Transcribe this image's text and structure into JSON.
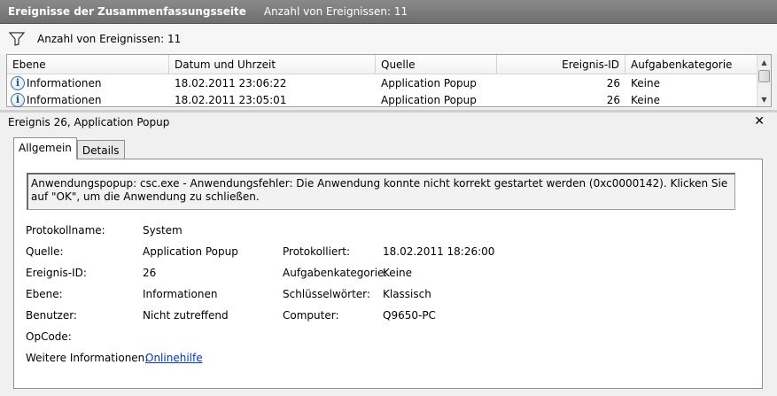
{
  "header": {
    "title": "Ereignisse der Zusammenfassungsseite",
    "count_label": "Anzahl von Ereignissen: 11"
  },
  "filter": {
    "label": "Anzahl von Ereignissen: 11",
    "icon": "filter-icon"
  },
  "grid": {
    "columns": [
      "Ebene",
      "Datum und Uhrzeit",
      "Quelle",
      "Ereignis-ID",
      "Aufgabenkategorie"
    ],
    "rows": [
      {
        "level": "Informationen",
        "datetime": "18.02.2011 23:06:22",
        "source": "Application Popup",
        "event_id": "26",
        "task": "Keine",
        "icon": "info-icon"
      },
      {
        "level": "Informationen",
        "datetime": "18.02.2011 23:05:01",
        "source": "Application Popup",
        "event_id": "26",
        "task": "Keine",
        "icon": "info-icon"
      }
    ]
  },
  "detail": {
    "title": "Ereignis 26, Application Popup",
    "close_label": "✕",
    "tabs": [
      "Allgemein",
      "Details"
    ],
    "message": "Anwendungspopup: csc.exe - Anwendungsfehler: Die Anwendung konnte nicht korrekt gestartet werden (0xc0000142). Klicken Sie auf \"OK\", um die Anwendung zu schließen.",
    "fields": {
      "protokollname_label": "Protokollname:",
      "protokollname": "System",
      "quelle_label": "Quelle:",
      "quelle": "Application Popup",
      "protokolliert_label": "Protokolliert:",
      "protokolliert": "18.02.2011 18:26:00",
      "ereignis_id_label": "Ereignis-ID:",
      "ereignis_id": "26",
      "aufgabenkategorie_label": "Aufgabenkategorie:",
      "aufgabenkategorie": "Keine",
      "ebene_label": "Ebene:",
      "ebene": "Informationen",
      "schluesselwoerter_label": "Schlüsselwörter:",
      "schluesselwoerter": "Klassisch",
      "benutzer_label": "Benutzer:",
      "benutzer": "Nicht zutreffend",
      "computer_label": "Computer:",
      "computer": "Q9650-PC",
      "opcode_label": "OpCode:",
      "opcode": "",
      "weitere_label": "Weitere Informationen:",
      "weitere_link": "Onlinehilfe"
    }
  },
  "colors": {
    "titlebar": "#7a7a7a",
    "link": "#0033cc"
  }
}
